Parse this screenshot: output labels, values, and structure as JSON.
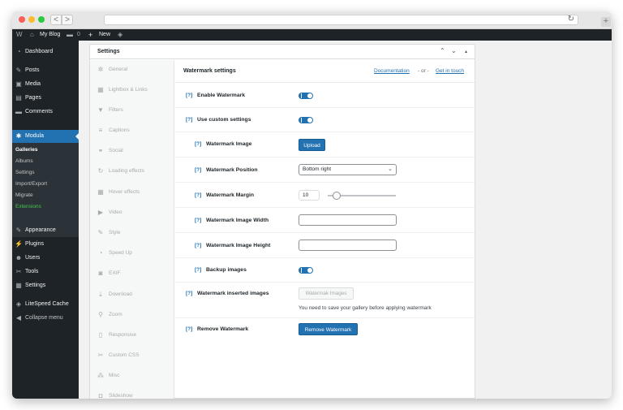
{
  "browser": {
    "back": "<",
    "forward": ">",
    "reload": "↻",
    "new_tab": "+"
  },
  "admin_bar": {
    "wp_logo": "W",
    "site_name": "My Blog",
    "comments_count": "0",
    "new_label": "New"
  },
  "sidebar": {
    "items": [
      {
        "icon": "dashboard-icon",
        "glyph": "◔",
        "label": "Dashboard"
      },
      {
        "icon": "posts-icon",
        "glyph": "✎",
        "label": "Posts"
      },
      {
        "icon": "media-icon",
        "glyph": "▣",
        "label": "Media"
      },
      {
        "icon": "pages-icon",
        "glyph": "▤",
        "label": "Pages"
      },
      {
        "icon": "comments-icon",
        "glyph": "▬",
        "label": "Comments"
      },
      {
        "icon": "modula-icon",
        "glyph": "✱",
        "label": "Modula"
      }
    ],
    "submenu": [
      "Galleries",
      "Albums",
      "Settings",
      "Import/Export",
      "Migrate",
      "Extensions"
    ],
    "items2": [
      {
        "icon": "appearance-icon",
        "glyph": "✎",
        "label": "Appearance"
      },
      {
        "icon": "plugins-icon",
        "glyph": "⚡",
        "label": "Plugins"
      },
      {
        "icon": "users-icon",
        "glyph": "☻",
        "label": "Users"
      },
      {
        "icon": "tools-icon",
        "glyph": "✂",
        "label": "Tools"
      },
      {
        "icon": "settings-icon",
        "glyph": "▦",
        "label": "Settings"
      },
      {
        "icon": "litespeed-icon",
        "glyph": "◈",
        "label": "LiteSpeed Cache"
      },
      {
        "icon": "collapse-icon",
        "glyph": "◀",
        "label": "Collapse menu"
      }
    ]
  },
  "panel": {
    "title": "Settings",
    "controls": {
      "up": "⌃",
      "down": "⌄",
      "toggle": "▴"
    }
  },
  "tabs": [
    {
      "icon": "gear-icon",
      "glyph": "✲",
      "label": "General"
    },
    {
      "icon": "lightbox-icon",
      "glyph": "▦",
      "label": "Lightbox & Links"
    },
    {
      "icon": "filter-icon",
      "glyph": "▼",
      "label": "Filters"
    },
    {
      "icon": "captions-icon",
      "glyph": "≡",
      "label": "Captions"
    },
    {
      "icon": "social-icon",
      "glyph": "⚭",
      "label": "Social"
    },
    {
      "icon": "loading-effects-icon",
      "glyph": "↻",
      "label": "Loading effects"
    },
    {
      "icon": "hover-effects-icon",
      "glyph": "▦",
      "label": "Hover effects"
    },
    {
      "icon": "video-icon",
      "glyph": "▶",
      "label": "Video"
    },
    {
      "icon": "style-icon",
      "glyph": "✎",
      "label": "Style"
    },
    {
      "icon": "speed-up-icon",
      "glyph": "◔",
      "label": "Speed Up"
    },
    {
      "icon": "exif-icon",
      "glyph": "◙",
      "label": "EXIF"
    },
    {
      "icon": "download-icon",
      "glyph": "⤓",
      "label": "Download"
    },
    {
      "icon": "zoom-icon",
      "glyph": "⚲",
      "label": "Zoom"
    },
    {
      "icon": "responsive-icon",
      "glyph": "▯",
      "label": "Responsive"
    },
    {
      "icon": "custom-css-icon",
      "glyph": "✂",
      "label": "Custom CSS"
    },
    {
      "icon": "misc-icon",
      "glyph": "⁂",
      "label": "Misc"
    },
    {
      "icon": "slideshow-icon",
      "glyph": "◘",
      "label": "Slideshow"
    }
  ],
  "content": {
    "title": "Watermark settings",
    "documentation": "Documentation",
    "or": "- or -",
    "get_in_touch": "Get in touch",
    "help": "[?]",
    "rows": {
      "enable": {
        "label": "Enable Watermark",
        "value": "on"
      },
      "custom": {
        "label": "Use custom settings",
        "value": "on"
      },
      "image": {
        "label": "Watermark Image",
        "button": "Upload"
      },
      "position": {
        "label": "Watermark Position",
        "value": "Bottom right"
      },
      "margin": {
        "label": "Watermark Margin",
        "value": "10"
      },
      "width": {
        "label": "Watermark Image Width",
        "value": ""
      },
      "height": {
        "label": "Watermark Image Height",
        "value": ""
      },
      "backup": {
        "label": "Backup images",
        "value": "on"
      },
      "inserted": {
        "label": "Watermark inserted images",
        "button": "Watermak Images",
        "note": "You need to save your gallery before applying watermark"
      },
      "remove": {
        "label": "Remove Watermark",
        "button": "Remove Watermark"
      }
    }
  },
  "colors": {
    "accent": "#2271b1",
    "sidebar_bg": "#1d2327",
    "extensions": "#47c447"
  }
}
